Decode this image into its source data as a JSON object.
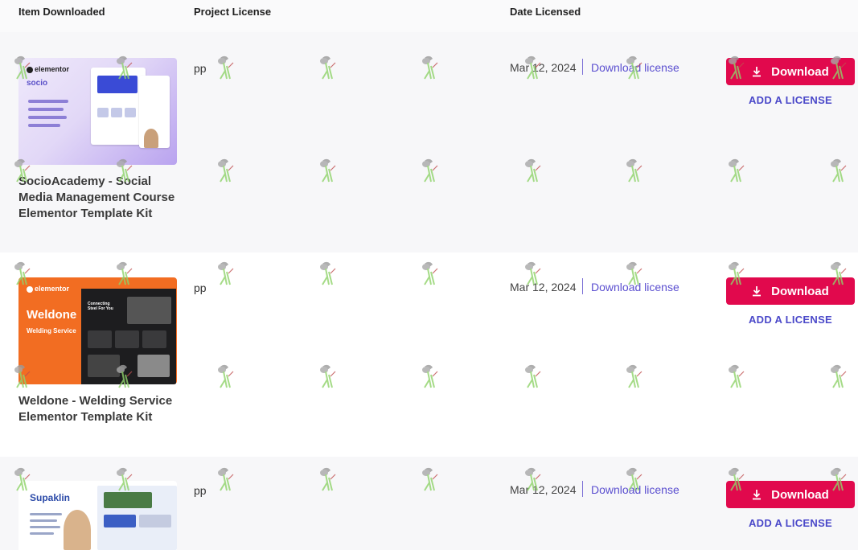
{
  "table": {
    "headers": {
      "item": "Item Downloaded",
      "license": "Project License",
      "date": "Date Licensed"
    },
    "rows": [
      {
        "title": "SocioAcademy - Social Media Management Course Elementor Template Kit",
        "thumb_brand": "elementor",
        "thumb_name": "socio",
        "project_license": "pp",
        "date": "Mar 12, 2024",
        "license_link": "Download license",
        "download_label": "Download",
        "add_license_label": "ADD A LICENSE"
      },
      {
        "title": "Weldone - Welding Service Elementor Template Kit",
        "thumb_brand": "elementor",
        "thumb_name": "Weldone",
        "thumb_sub": "Welding Service",
        "thumb_card": "Connecting Steel For You",
        "project_license": "pp",
        "date": "Mar 12, 2024",
        "license_link": "Download license",
        "download_label": "Download",
        "add_license_label": "ADD A LICENSE"
      },
      {
        "title": "",
        "thumb_name": "Supaklin",
        "project_license": "pp",
        "date": "Mar 12, 2024",
        "license_link": "Download license",
        "download_label": "Download",
        "add_license_label": "ADD A LICENSE"
      }
    ]
  },
  "colors": {
    "accent_button": "#e1094d",
    "link": "#5b4fd0",
    "add_license": "#4a48c9"
  },
  "icons": {
    "download": "download-icon",
    "watermark": "watering-can-watermark-icon"
  }
}
